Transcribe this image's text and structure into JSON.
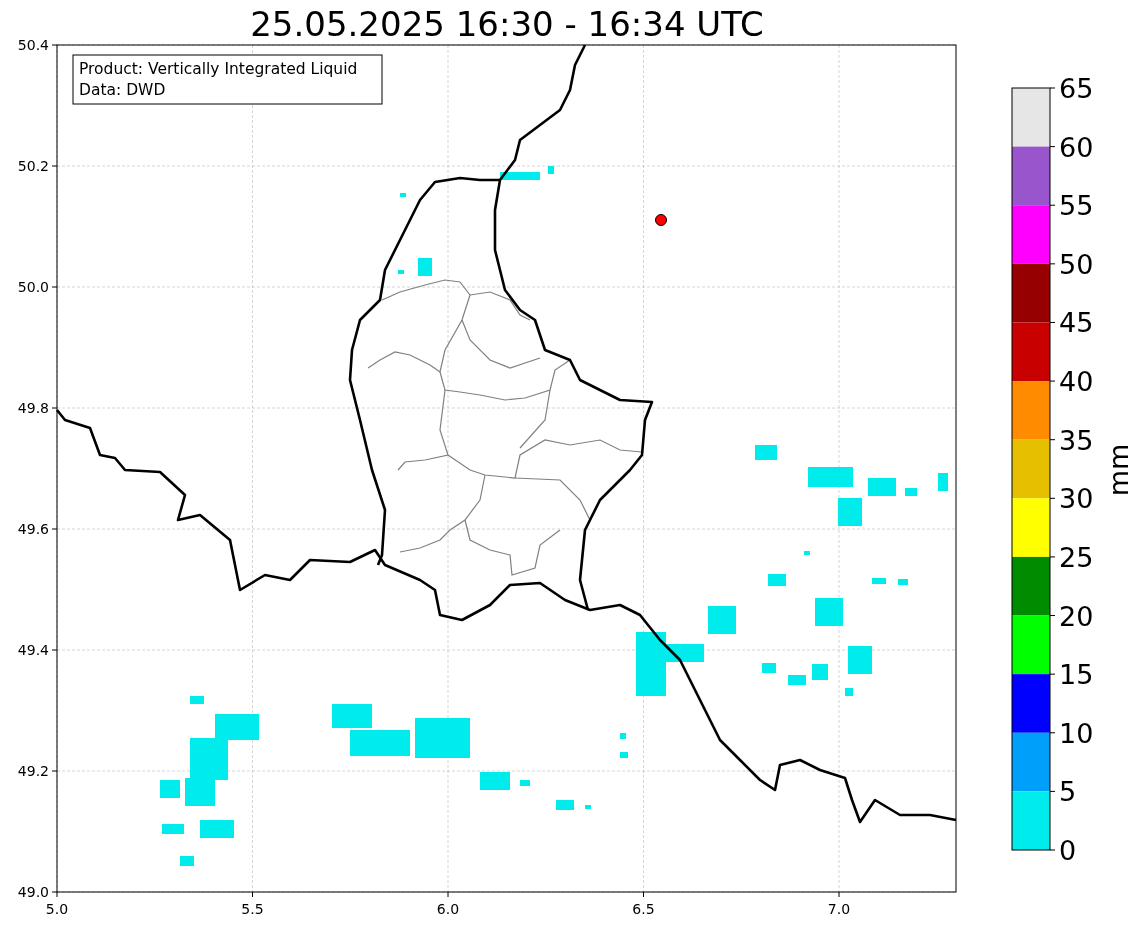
{
  "title": "25.05.2025 16:30 - 16:34 UTC",
  "info_box": {
    "lines": [
      "Product: Vertically Integrated Liquid",
      "Data: DWD"
    ]
  },
  "map": {
    "xticks": [
      "5.0",
      "5.5",
      "6.0",
      "6.5",
      "7.0"
    ],
    "yticks": [
      "50.4",
      "50.2",
      "50.0",
      "49.8",
      "49.6",
      "49.4",
      "49.2",
      "49.0"
    ]
  },
  "colorbar": {
    "unit": "mm",
    "ticks": [
      "65",
      "60",
      "55",
      "50",
      "45",
      "40",
      "35",
      "30",
      "25",
      "20",
      "15",
      "10",
      "5",
      "0"
    ],
    "bins": [
      {
        "color": "#e6e6e6"
      },
      {
        "color": "#9955cc"
      },
      {
        "color": "#ff00ff"
      },
      {
        "color": "#960000"
      },
      {
        "color": "#c80000"
      },
      {
        "color": "#ff8c00"
      },
      {
        "color": "#e6c000"
      },
      {
        "color": "#ffff00"
      },
      {
        "color": "#008c00"
      },
      {
        "color": "#00ff00"
      },
      {
        "color": "#0000ff"
      },
      {
        "color": "#009ffa"
      },
      {
        "color": "#00ebeb"
      }
    ]
  }
}
